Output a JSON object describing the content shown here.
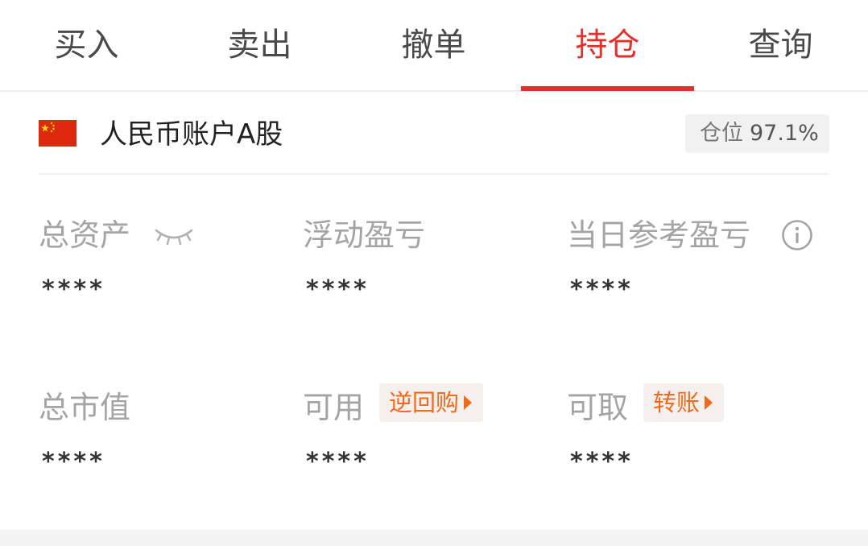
{
  "tabs": [
    {
      "label": "买入",
      "active": false
    },
    {
      "label": "卖出",
      "active": false
    },
    {
      "label": "撤单",
      "active": false
    },
    {
      "label": "持仓",
      "active": true
    },
    {
      "label": "查询",
      "active": false
    }
  ],
  "account": {
    "flag_icon": "china-flag-icon",
    "name": "人民币账户A股",
    "position_label": "仓位",
    "position_value": "97.1%"
  },
  "stats": {
    "total_assets": {
      "label": "总资产",
      "value": "****",
      "icon": "eye-closed-icon"
    },
    "floating_pnl": {
      "label": "浮动盈亏",
      "value": "****"
    },
    "daily_pnl": {
      "label": "当日参考盈亏",
      "value": "****",
      "icon": "info-icon"
    },
    "market_value": {
      "label": "总市值",
      "value": "****"
    },
    "available": {
      "label": "可用",
      "value": "****",
      "action": "逆回购"
    },
    "withdrawable": {
      "label": "可取",
      "value": "****",
      "action": "转账"
    }
  },
  "colors": {
    "accent": "#e2302b",
    "action": "#f06a1c",
    "muted_label": "#a4a4a4"
  }
}
